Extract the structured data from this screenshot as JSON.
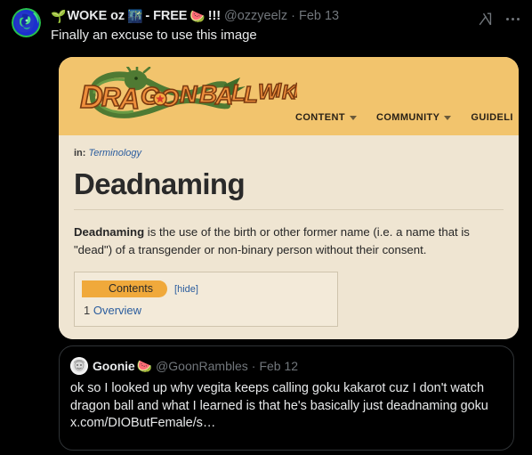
{
  "post": {
    "author": {
      "display_name_part1": "WOKE oz",
      "display_name_part2": "- FREE",
      "emoji_seedling": "🌱",
      "emoji_city": "🌃",
      "emoji_watermelon": "🍉",
      "exclaim": "!!!",
      "handle": "@ozzyeelz",
      "separator": "·",
      "date": "Feb 13",
      "avatar_name": "ozzyeelz-avatar"
    },
    "text": "Finally an excuse to use this image",
    "actions": {
      "grok_label": "Grok actions",
      "more_label": "More"
    }
  },
  "media": {
    "alt": "Dragon Ball Wiki article screenshot — Deadnaming",
    "wiki": {
      "logo_text": "DRAGON BALL WIKI",
      "nav": [
        {
          "label": "CONTENT",
          "has_caret": true
        },
        {
          "label": "COMMUNITY",
          "has_caret": true
        },
        {
          "label": "GUIDELI",
          "has_caret": false
        }
      ],
      "breadcrumb_prefix": "in:",
      "breadcrumb_category": "Terminology",
      "article_title": "Deadnaming",
      "article_lead_bold": "Deadnaming",
      "article_lead_rest": " is the use of the birth or other former name (i.e. a name that is \"dead\") of a transgender or non-binary person without their consent.",
      "toc_title": "Contents",
      "toc_hide": "[hide]",
      "toc_items": [
        {
          "number": "1",
          "label": "Overview"
        }
      ]
    },
    "colors": {
      "header_bg": "#f2c46d",
      "page_bg": "#efe5d2",
      "logo_orange": "#e88a33",
      "dragon_green": "#4f7a33",
      "toc_pill": "#f0a93b",
      "link_blue": "#2b5d9e"
    }
  },
  "quoted_post": {
    "author": {
      "display_name": "Goonie",
      "emoji_watermelon": "🍉",
      "handle": "@GoonRambles",
      "separator": "·",
      "date": "Feb 12",
      "avatar_name": "goonrambles-avatar"
    },
    "text": "ok so I looked up why vegita keeps calling goku kakarot cuz I don't watch dragon ball and what I learned is that he's basically just deadnaming goku x.com/DIOButFemale/s…"
  },
  "theme": {
    "background": "#000000",
    "text_primary": "#e7e9ea",
    "text_muted": "#71767b",
    "border": "#2f3336"
  }
}
